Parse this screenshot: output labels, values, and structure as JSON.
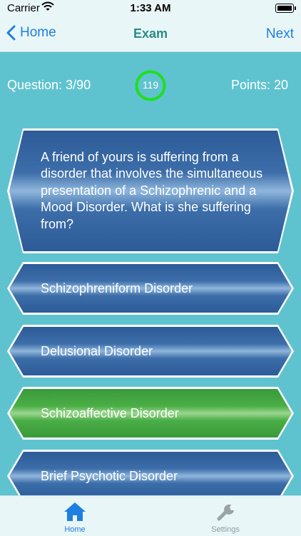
{
  "status": {
    "carrier": "Carrier",
    "time": "1:33 AM"
  },
  "nav": {
    "back_label": "Home",
    "title": "Exam",
    "next_label": "Next"
  },
  "progress": {
    "question": "Question: 3/90",
    "timer": "119",
    "points": "Points: 20"
  },
  "question": {
    "text": "A friend of yours is suffering from a disorder that involves the simultaneous presentation of a Schizophrenic and a Mood Disorder. What is she suffering from?"
  },
  "answers": [
    {
      "label": "Schizophreniform Disorder",
      "state": "default"
    },
    {
      "label": "Delusional Disorder",
      "state": "default"
    },
    {
      "label": "Schizoaffective Disorder",
      "state": "correct"
    },
    {
      "label": "Brief Psychotic Disorder",
      "state": "default"
    }
  ],
  "tabs": [
    {
      "label": "Home",
      "icon": "home-icon",
      "active": true
    },
    {
      "label": "Settings",
      "icon": "wrench-icon",
      "active": false
    }
  ],
  "colors": {
    "accent": "#1e7fe0",
    "title": "#2c8a86",
    "background": "#5fc3cf",
    "answer_blue": "#3d6ea9",
    "answer_green": "#4aae46",
    "timer_ring": "#22dd22"
  }
}
